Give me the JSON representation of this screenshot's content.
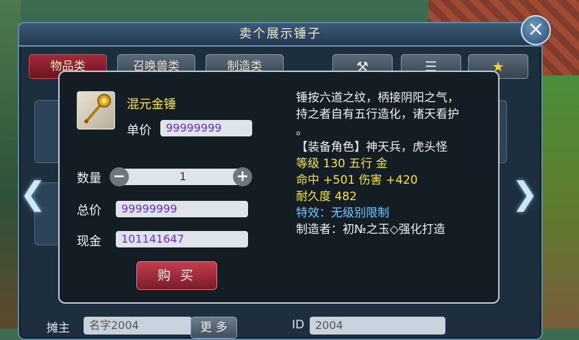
{
  "window": {
    "title": "卖个展示锤子"
  },
  "tabs": [
    {
      "label": "物品类"
    },
    {
      "label": "召唤兽类"
    },
    {
      "label": "制造类"
    }
  ],
  "toolbar_icons": [
    "hammer-icon",
    "list-icon",
    "star-icon"
  ],
  "bottom": {
    "stall_owner_label": "摊主",
    "stall_owner_value": "名字2004",
    "more_button": "更 多",
    "id_label": "ID",
    "id_value": "2004"
  },
  "dialog": {
    "item_name": "混元金锤",
    "unit_price_label": "单价",
    "unit_price_value": "99999999",
    "quantity_label": "数量",
    "quantity_value": "1",
    "total_label": "总价",
    "total_value": "99999999",
    "cash_label": "现金",
    "cash_value": "101141647",
    "buy_button": "购 买",
    "description": [
      "锤按六道之纹，柄接阴阳之气，",
      "持之者自有五行造化，诸天看护",
      "。",
      "【装备角色】神天兵，虎头怪"
    ],
    "stats": {
      "level_element": "等级 130  五行 金",
      "hit_damage": "命中 +501 伤害 +420",
      "durability": "耐久度 482"
    },
    "special_effect": "特效：无级别限制",
    "maker": "制造者：初№之玉◇强化打造"
  },
  "colors": {
    "item_name": "#f6e24a",
    "stat_text": "#f2e24a",
    "special_effect": "#6cc9ff",
    "price_text": "#6a2fd1",
    "buy_button": "#c43e4f",
    "active_tab": "#a12a3a"
  }
}
